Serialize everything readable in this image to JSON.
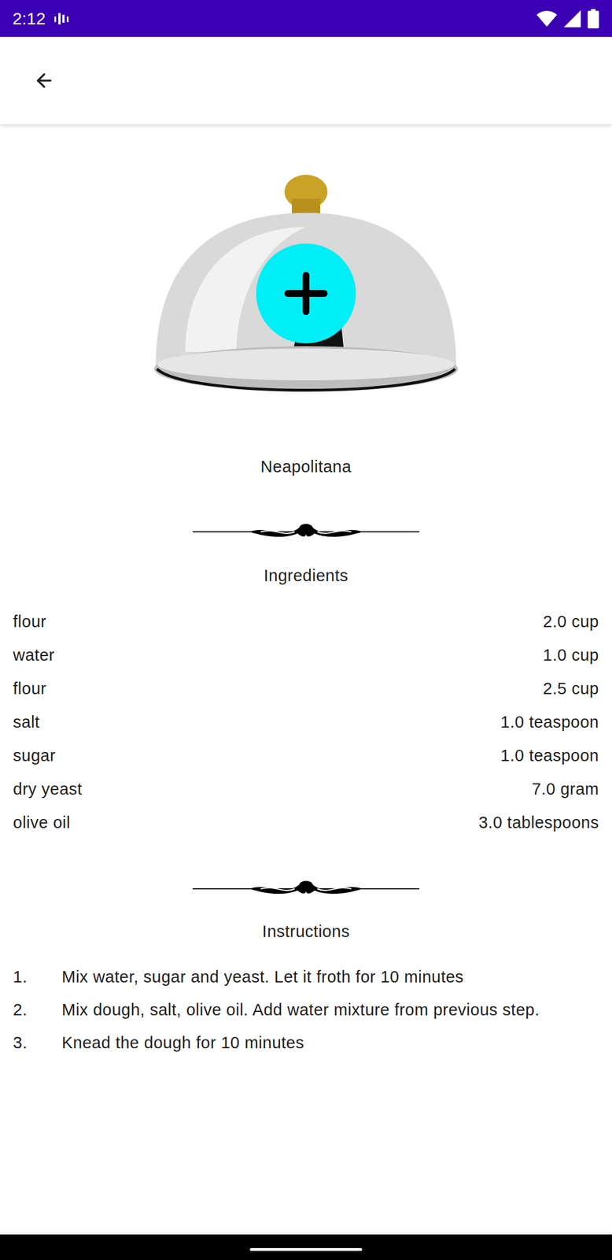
{
  "status_bar": {
    "time": "2:12"
  },
  "recipe": {
    "title": "Neapolitana"
  },
  "ingredients": {
    "heading": "Ingredients",
    "items": [
      {
        "name": "flour",
        "amount": "2.0 cup"
      },
      {
        "name": "water",
        "amount": "1.0 cup"
      },
      {
        "name": "flour",
        "amount": "2.5 cup"
      },
      {
        "name": "salt",
        "amount": "1.0 teaspoon"
      },
      {
        "name": "sugar",
        "amount": "1.0 teaspoon"
      },
      {
        "name": "dry yeast",
        "amount": "7.0 gram"
      },
      {
        "name": "olive oil",
        "amount": "3.0 tablespoons"
      }
    ]
  },
  "instructions": {
    "heading": "Instructions",
    "steps": [
      {
        "number": "1.",
        "text": "Mix water, sugar and yeast. Let it froth for 10 minutes"
      },
      {
        "number": "2.",
        "text": "Mix dough, salt, olive oil. Add water mixture from previous step."
      },
      {
        "number": "3.",
        "text": "Knead the dough for 10 minutes"
      }
    ]
  }
}
